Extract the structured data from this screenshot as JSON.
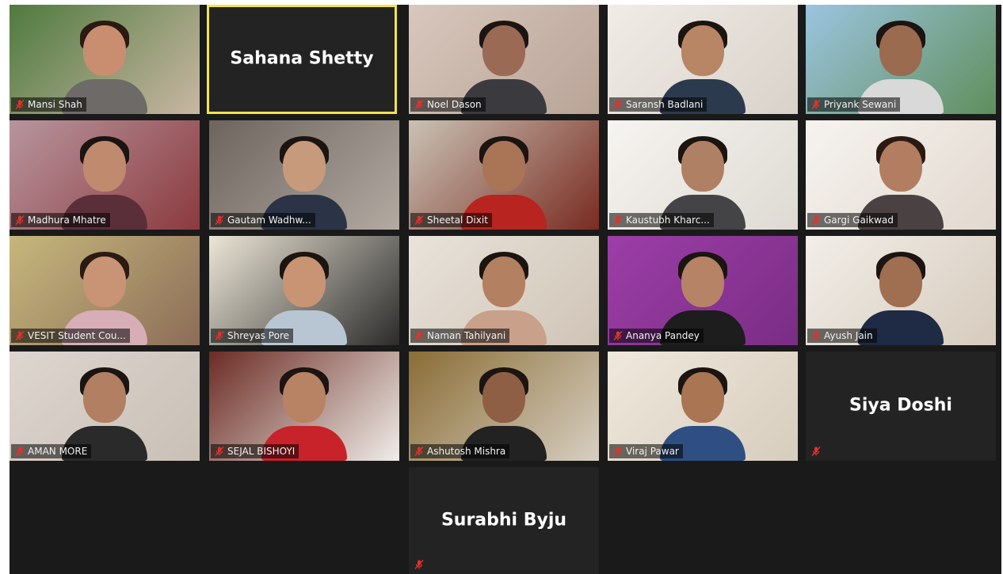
{
  "meeting": {
    "participants": [
      {
        "name": "Mansi Shah",
        "video": true,
        "bg": [
          "#4f7a3e",
          "#c9b7a3"
        ],
        "skin": "#c98d6f",
        "hair": "#2a1a12",
        "shirt": "#6d6a68"
      },
      {
        "name": "Sahana Shetty",
        "video": false,
        "active_speaker": true
      },
      {
        "name": "Noel Dason",
        "video": true,
        "bg": [
          "#d8c7bd",
          "#b9a497"
        ],
        "skin": "#9a6a55",
        "hair": "#1b1411",
        "shirt": "#3b3b3f"
      },
      {
        "name": "Saransh Badlani",
        "video": true,
        "bg": [
          "#f1ece6",
          "#d8d2ca"
        ],
        "skin": "#b88565",
        "hair": "#1b1411",
        "shirt": "#2c3a4e"
      },
      {
        "name": "Priyank Sewani",
        "video": true,
        "bg": [
          "#9cc4e0",
          "#5f8f5c"
        ],
        "skin": "#9a6b4f",
        "hair": "#1b1411",
        "shirt": "#d9d9d9"
      },
      {
        "name": "Madhura Mhatre",
        "video": true,
        "bg": [
          "#b8959e",
          "#8b3a3e"
        ],
        "skin": "#c08a6f",
        "hair": "#1b1411",
        "shirt": "#5a2f3a"
      },
      {
        "name": "Gautam Wadhw...",
        "video": true,
        "bg": [
          "#6d645e",
          "#b3aba2"
        ],
        "skin": "#c79a7c",
        "hair": "#1b1411",
        "shirt": "#2b3446"
      },
      {
        "name": "Sheetal Dixit",
        "video": true,
        "bg": [
          "#c9c2b4",
          "#7a2b21"
        ],
        "skin": "#a97556",
        "hair": "#1b1411",
        "shirt": "#b8241f"
      },
      {
        "name": "Kaustubh Kharc...",
        "video": true,
        "bg": [
          "#f6f4f0",
          "#dedad3"
        ],
        "skin": "#b08064",
        "hair": "#1b1411",
        "shirt": "#444446"
      },
      {
        "name": "Gargi Gaikwad",
        "video": true,
        "bg": [
          "#f6f3ef",
          "#e2d9cf"
        ],
        "skin": "#b27d60",
        "hair": "#2a1a12",
        "shirt": "#4a4142"
      },
      {
        "name": "VESIT Student Cou...",
        "video": true,
        "bg": [
          "#c6b77c",
          "#8c6d58"
        ],
        "skin": "#c99375",
        "hair": "#2a1a12",
        "shirt": "#d7aeb7"
      },
      {
        "name": "Shreyas Pore",
        "video": true,
        "bg": [
          "#ece6d6",
          "#2b2b2b"
        ],
        "skin": "#c99473",
        "hair": "#1b1411",
        "shirt": "#b8c6d3"
      },
      {
        "name": "Naman Tahilyani",
        "video": true,
        "bg": [
          "#e9e3da",
          "#cfc4b6"
        ],
        "skin": "#b48062",
        "hair": "#1b1411",
        "shirt": "#c9a08a"
      },
      {
        "name": "Ananya Pandey",
        "video": true,
        "bg": [
          "#9c3ea7",
          "#7a2d85"
        ],
        "skin": "#b68367",
        "hair": "#1b1411",
        "shirt": "#1d1d1d"
      },
      {
        "name": "Ayush Jain",
        "video": true,
        "bg": [
          "#f2eee8",
          "#d6cbbd"
        ],
        "skin": "#a06e50",
        "hair": "#1b1411",
        "shirt": "#1f2a44"
      },
      {
        "name": "AMAN MORE",
        "video": true,
        "bg": [
          "#ddd6cf",
          "#c9c0b6"
        ],
        "skin": "#b27f63",
        "hair": "#1b1411",
        "shirt": "#2a2a2a"
      },
      {
        "name": "SEJAL BISHOYI",
        "video": true,
        "bg": [
          "#6b2c24",
          "#f0ede8"
        ],
        "skin": "#b88264",
        "hair": "#1b1411",
        "shirt": "#c8232a"
      },
      {
        "name": "Ashutosh Mishra",
        "video": true,
        "bg": [
          "#8a6d36",
          "#d7cfc2"
        ],
        "skin": "#8e5f45",
        "hair": "#1b1411",
        "shirt": "#222222"
      },
      {
        "name": "Viraj Pawar",
        "video": true,
        "bg": [
          "#efe8dc",
          "#d7cdbd"
        ],
        "skin": "#a97553",
        "hair": "#1b1411",
        "shirt": "#2f4f83"
      },
      {
        "name": "Siya Doshi",
        "video": false
      },
      {
        "name": "Surabhi Byju",
        "video": false
      }
    ],
    "icons": {
      "muted": "muted-mic-icon"
    },
    "colors": {
      "active_border": "#f3e34a",
      "tile_bg": "#232323",
      "gallery_bg": "#1a1a1a",
      "muted_red": "#e0322f"
    }
  }
}
